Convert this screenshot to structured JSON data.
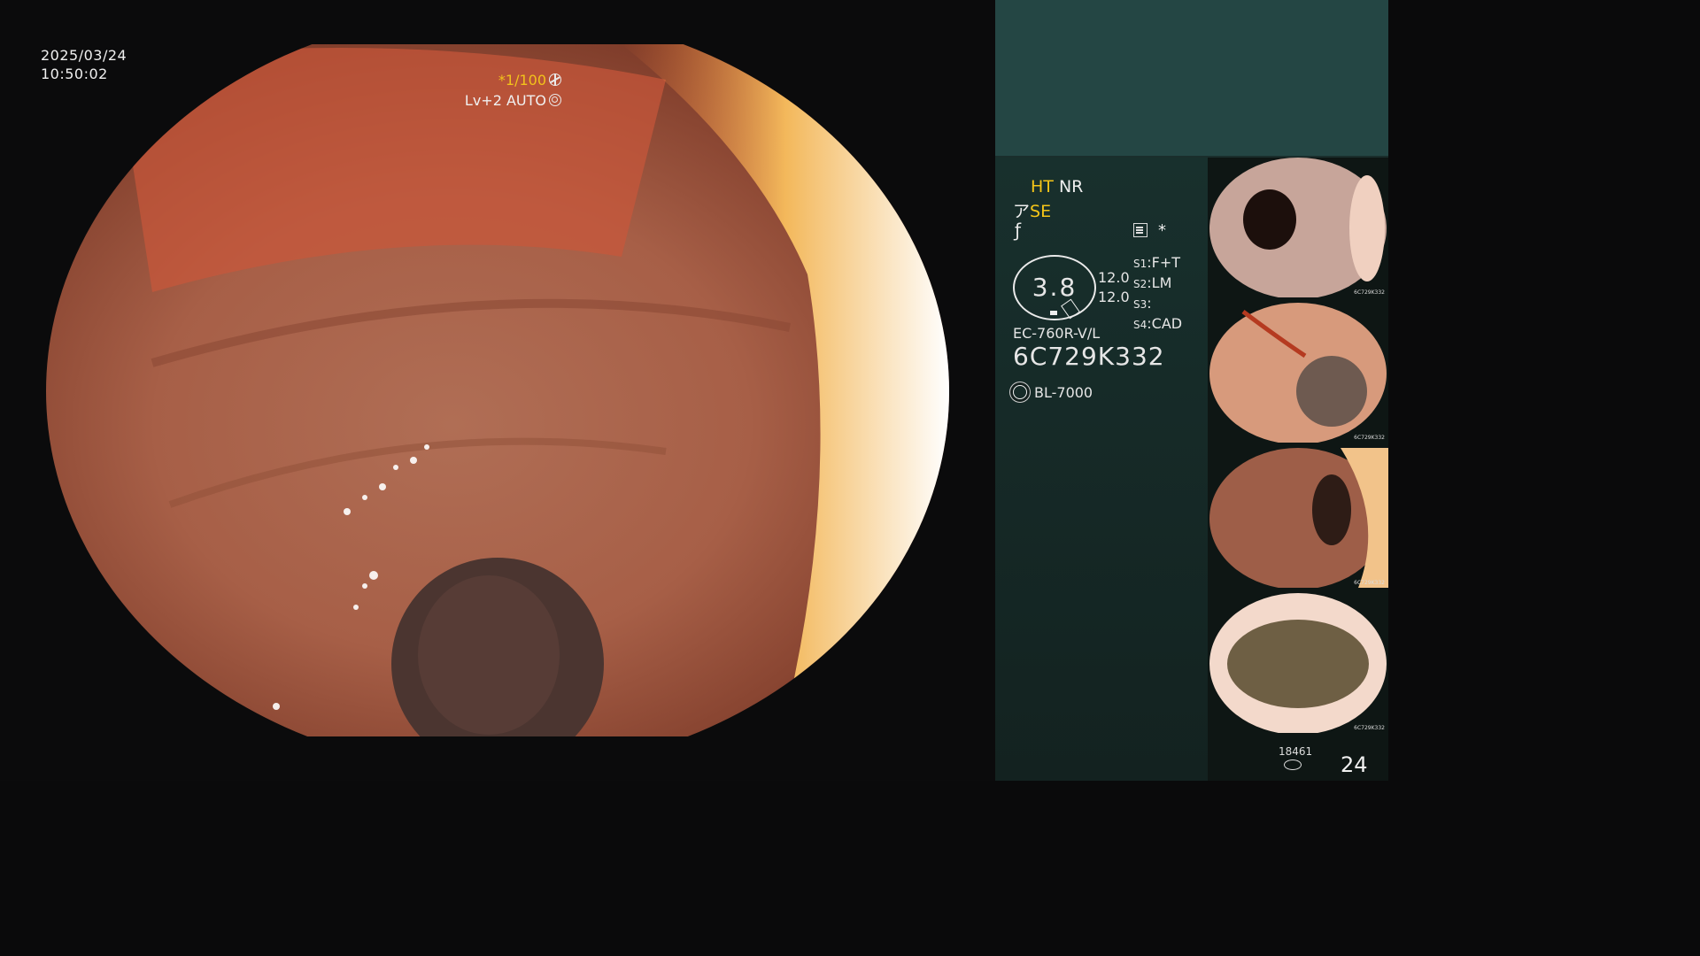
{
  "overlay": {
    "date": "2025/03/24",
    "time": "10:50:02",
    "ratio": "*1/100",
    "level": "Lv+2 AUTO",
    "shutter_icon": "aperture-icon",
    "auto_icon": "ring-icon"
  },
  "status": {
    "ht": "HT",
    "nr": "NR",
    "se": "SE",
    "se_prefix": "ア",
    "f_symbol": "ƒ",
    "asterisk": "*",
    "circle_value": "3.8",
    "val1": "12.0",
    "val2": "12.0",
    "slots": [
      {
        "key": "S1",
        "value": "F+T"
      },
      {
        "key": "S2",
        "value": "LM"
      },
      {
        "key": "S3",
        "value": ""
      },
      {
        "key": "S4",
        "value": "CAD"
      }
    ],
    "model": "EC-760R-V/L",
    "serial": "6C729K332",
    "light_source": "BL-7000"
  },
  "thumbnails": [
    {
      "serial": "6C729K332"
    },
    {
      "serial": "6C729K332"
    },
    {
      "serial": "6C729K332"
    },
    {
      "serial": "6C729K332"
    }
  ],
  "footer": {
    "small_count": "18461",
    "big_count": "24"
  },
  "colors": {
    "accent": "#f5c518",
    "panel_top": "#244644",
    "panel_bg": "#14201e"
  }
}
